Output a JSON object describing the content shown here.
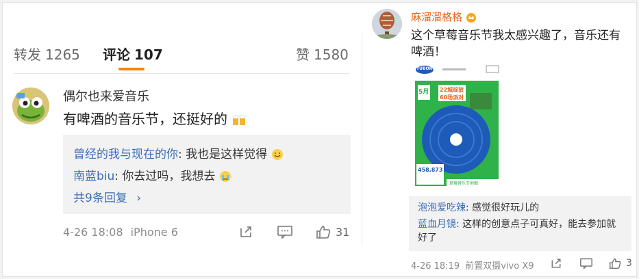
{
  "tabs": {
    "repost_label": "转发",
    "repost_count": "1265",
    "comment_label": "评论",
    "comment_count": "107",
    "like_label": "赞",
    "like_count": "1580"
  },
  "left_comment": {
    "username": "偶尔也来爱音乐",
    "text": "有啤酒的音乐节，还挺好的",
    "replies": [
      {
        "name": "曾经的我与现在的你",
        "text": ": 我也是这样觉得"
      },
      {
        "name": "南蓝biu",
        "text": ": 你去过吗，我想去"
      }
    ],
    "more_replies": "共9条回复",
    "time": "4-26 18:08",
    "device": "iPhone 6",
    "like_count": "31"
  },
  "right_comment": {
    "username": "麻溜溜格格",
    "text": "这个草莓音乐节我太感兴趣了，音乐还有啤酒！",
    "poster": {
      "brand": "TUBORG",
      "date_big": "5月",
      "badge_line1": "22城绽放",
      "badge_line2": "60场派对",
      "count": "458,873",
      "bottom_label": "草莓音乐节地图"
    },
    "replies": [
      {
        "name": "泡泡爱吃辣",
        "text": ": 感觉很好玩儿的"
      },
      {
        "name": "蓝血月镜",
        "text": ": 这样的创意点子可真好，能去参加就好了"
      }
    ],
    "time": "4-26 18:19",
    "device": "前置双摄vivo X9",
    "like_count": "3"
  },
  "colors": {
    "accent": "#ff8200",
    "link": "#3b6cb7",
    "poster_green": "#2fb24a",
    "poster_blue": "#1e5bb8"
  }
}
